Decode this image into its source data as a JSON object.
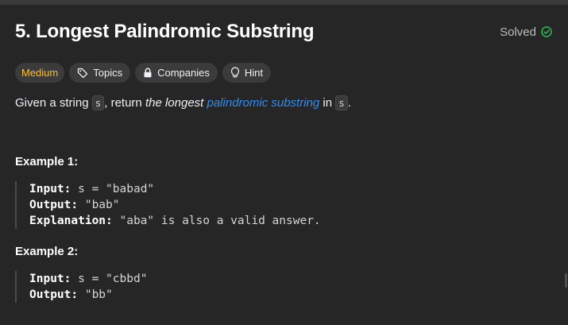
{
  "problem": {
    "title": "5. Longest Palindromic Substring",
    "status": "Solved"
  },
  "tags": {
    "difficulty": "Medium",
    "topics": "Topics",
    "companies": "Companies",
    "hint": "Hint"
  },
  "description": {
    "part1": "Given a string ",
    "code1": "s",
    "part2": ", return ",
    "emph": "the longest",
    "space": " ",
    "link": "palindromic substring",
    "part3": " in ",
    "code2": "s",
    "part4": "."
  },
  "examples": [
    {
      "title": "Example 1:",
      "input_label": "Input:",
      "input_value": " s = \"babad\"",
      "output_label": "Output:",
      "output_value": " \"bab\"",
      "explanation_label": "Explanation:",
      "explanation_value": " \"aba\" is also a valid answer."
    },
    {
      "title": "Example 2:",
      "input_label": "Input:",
      "input_value": " s = \"cbbd\"",
      "output_label": "Output:",
      "output_value": " \"bb\""
    }
  ],
  "colors": {
    "background": "#262626",
    "difficulty_medium": "#ffc01e",
    "link": "#2f8cf2",
    "solved_check": "#2cbb5d"
  }
}
